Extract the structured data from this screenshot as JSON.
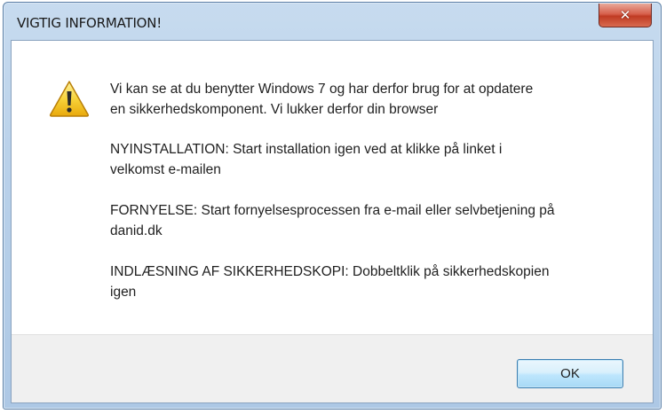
{
  "window": {
    "title": "VIGTIG INFORMATION!",
    "close_icon": "close-icon",
    "close_symbol": "✕"
  },
  "dialog": {
    "icon": "warning-icon",
    "messages": [
      {
        "line1": "Vi kan se at du benytter Windows 7 og har derfor brug for at opdatere",
        "line2": "en sikkerhedskomponent. Vi lukker derfor din browser"
      },
      {
        "line1": "NYINSTALLATION: Start installation igen ved at klikke på linket i",
        "line2": "velkomst e-mailen"
      },
      {
        "line1": "FORNYELSE: Start fornyelsesprocessen fra e-mail eller selvbetjening på",
        "line2": "danid.dk"
      },
      {
        "line1": "INDLÆSNING AF SIKKERHEDSKOPI:  Dobbeltklik på sikkerhedskopien",
        "line2": "igen"
      }
    ],
    "ok_label": "OK"
  },
  "colors": {
    "titlebar": "#b9d1ea",
    "close_button": "#c9432a",
    "warning_fill": "#f5c518",
    "ok_button": "#bee6fd",
    "footer": "#f0f0f0"
  }
}
